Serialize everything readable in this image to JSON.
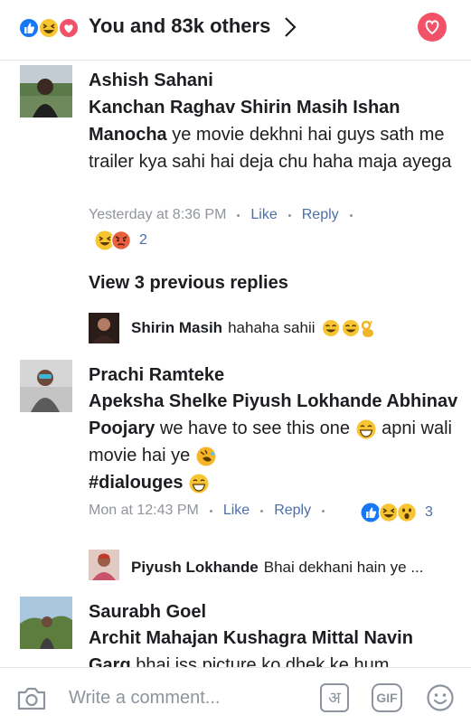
{
  "header": {
    "title": "You and 83k others",
    "reaction_icons": [
      "like-icon",
      "haha-icon",
      "love-icon"
    ],
    "accent_color": "#f25268"
  },
  "comments": [
    {
      "author": "Ashish Sahani",
      "tagged": "Kanchan Raghav Shirin Masih Ishan Manocha",
      "text": " ye movie dekhni hai guys sath me trailer kya sahi hai deja chu haha maja ayega",
      "time": "Yesterday at 8:36 PM",
      "like_label": "Like",
      "reply_label": "Reply",
      "reaction_count": "2"
    },
    {
      "author": "Prachi Ramteke",
      "tagged": "Apeksha Shelke Piyush Lokhande Abhinav Poojary",
      "text_part1": " we have to see this one ",
      "text_part2": " apni wali movie hai ye ",
      "text_part3": "#dialouges ",
      "time": "Mon at 12:43 PM",
      "like_label": "Like",
      "reply_label": "Reply",
      "reaction_count": "3"
    },
    {
      "author": "Saurabh Goel",
      "tagged": "Archit Mahajan Kushagra Mittal Navin Garg",
      "text": " bhai iss picture ko dhek ke hum"
    }
  ],
  "view_previous": "View 3 previous replies",
  "replies": [
    {
      "author": "Shirin Masih",
      "text": "hahaha sahii"
    },
    {
      "author": "Piyush Lokhande",
      "text": "Bhai dekhani hain ye ..."
    }
  ],
  "composer": {
    "placeholder": "Write a comment...",
    "hindi_label": "अ",
    "gif_label": "GIF"
  }
}
